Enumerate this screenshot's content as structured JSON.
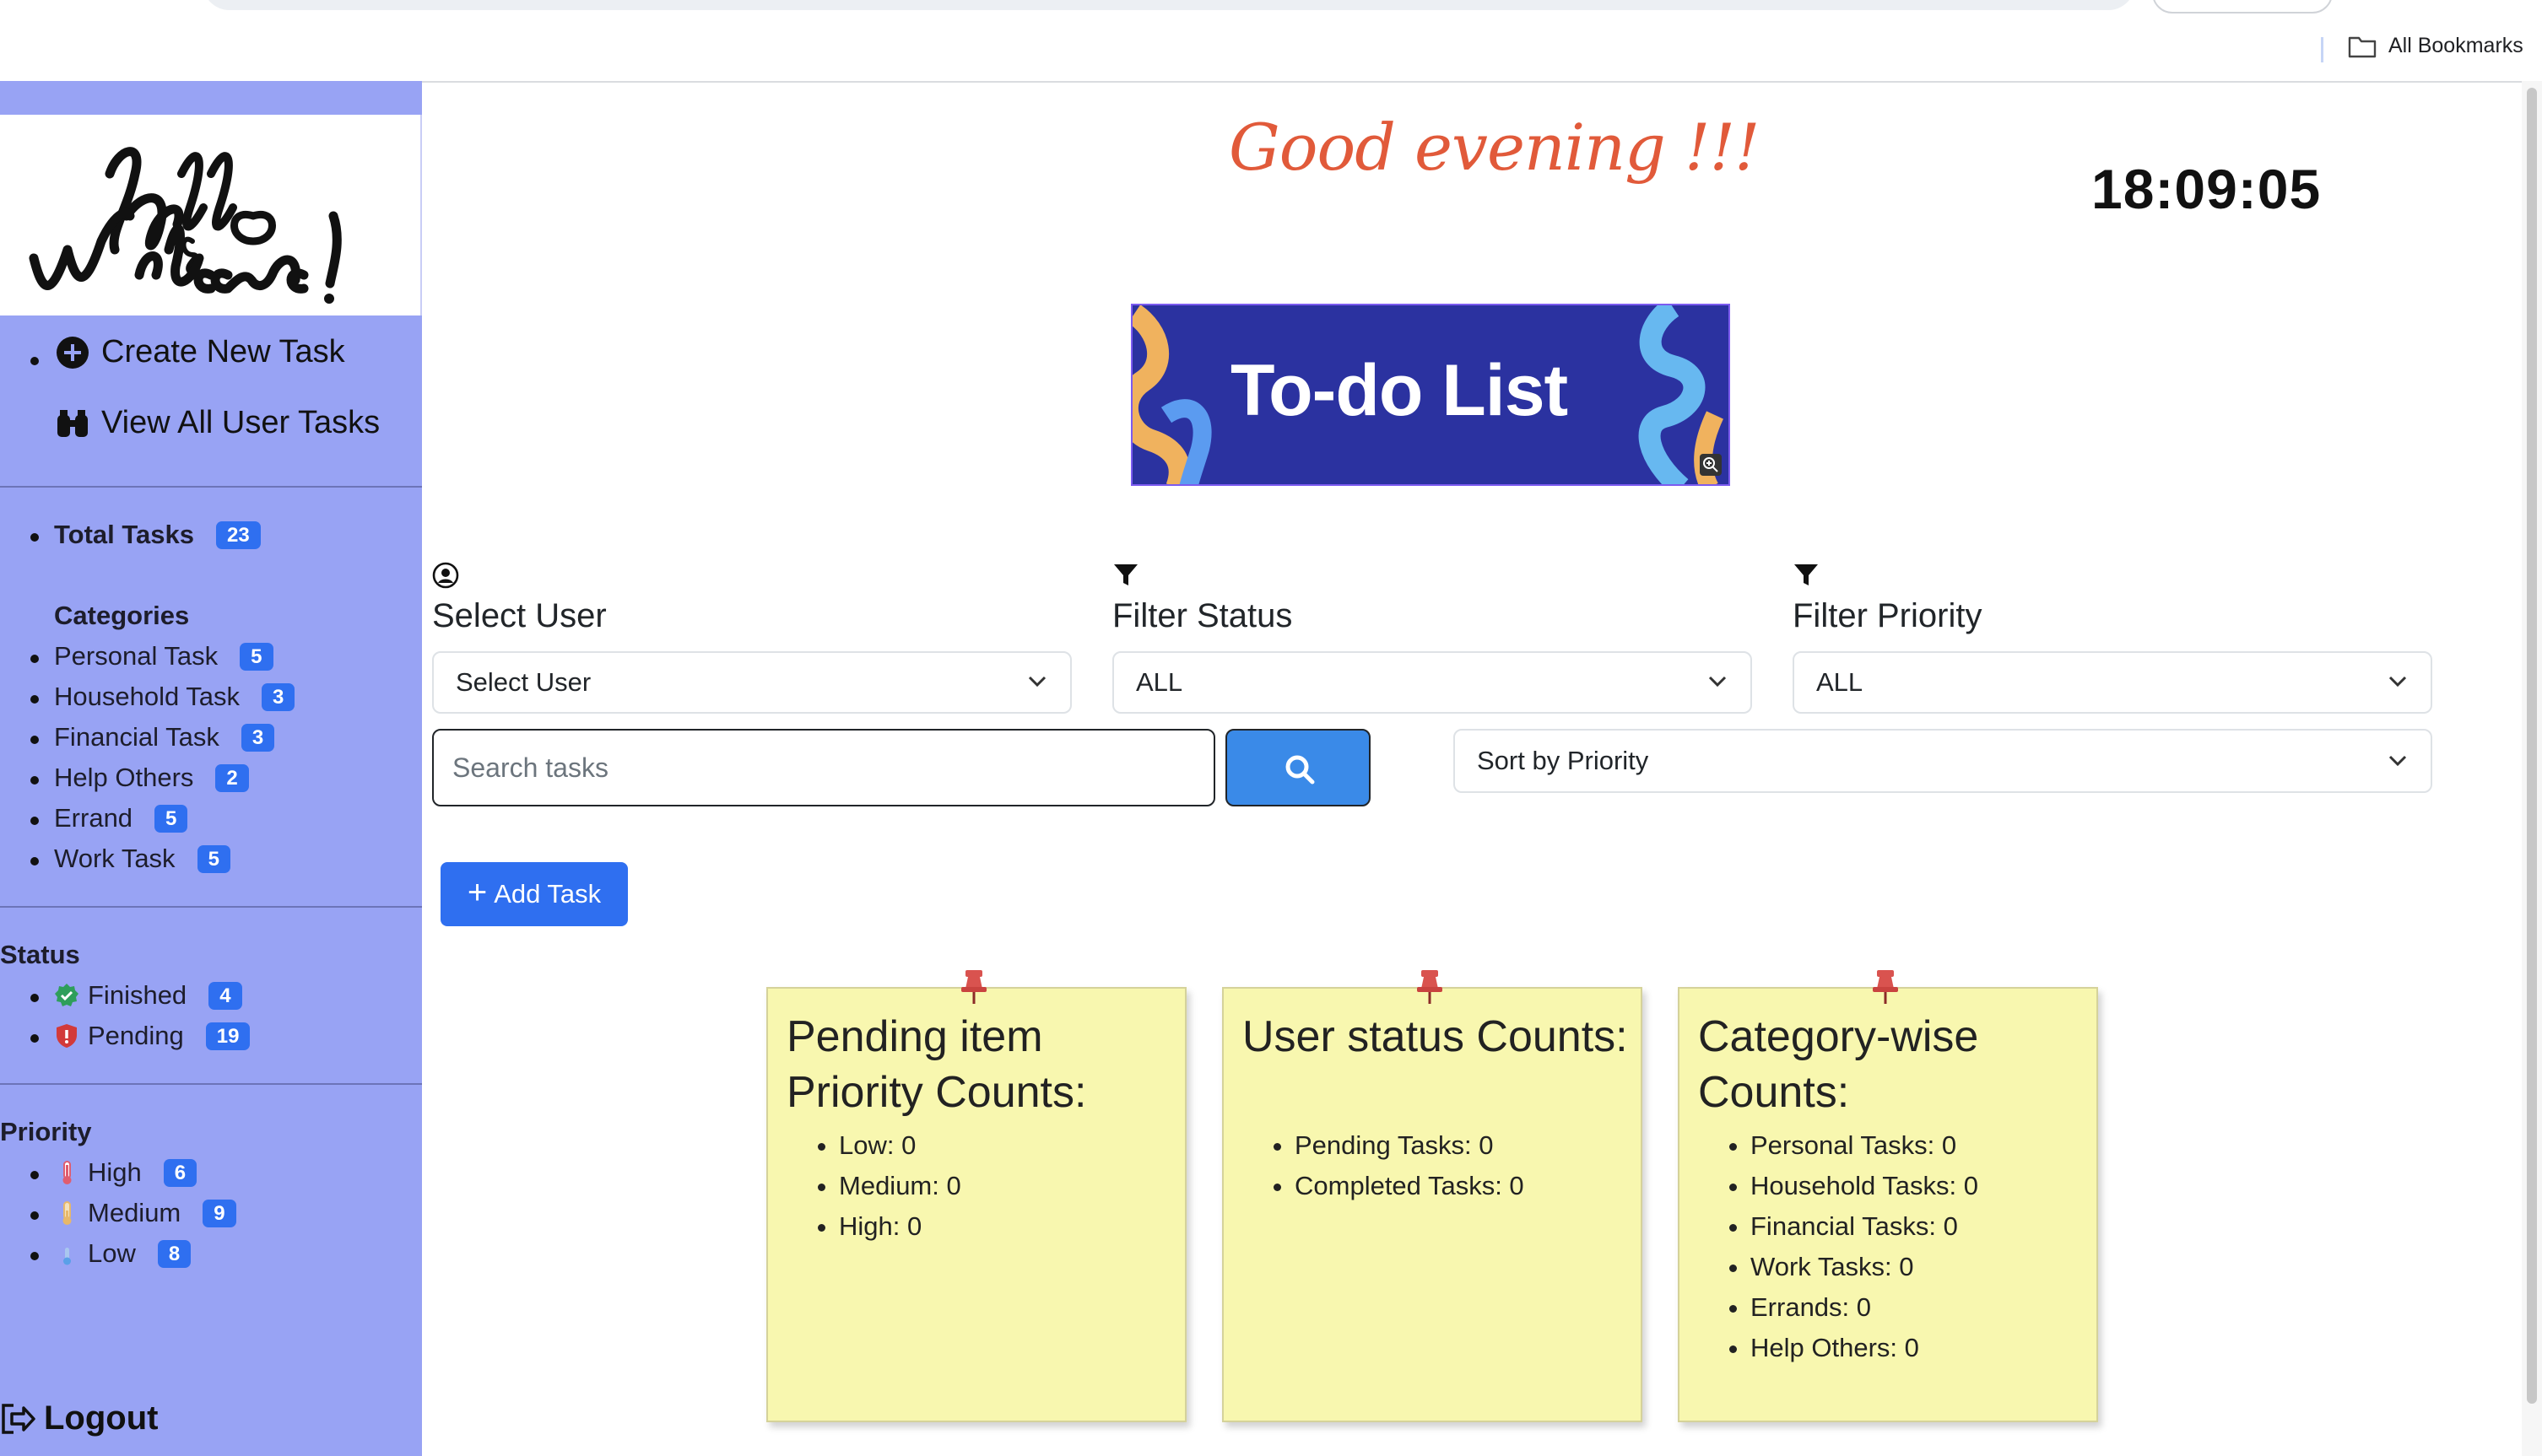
{
  "browser": {
    "bookmarks_label": "All Bookmarks"
  },
  "sidebar": {
    "links": [
      {
        "label": "Create New Task",
        "icon": "plus-circle-icon"
      },
      {
        "label": "View All User Tasks",
        "icon": "binoculars-icon"
      }
    ],
    "total": {
      "label": "Total Tasks",
      "count": "23"
    },
    "categories_heading": "Categories",
    "categories": [
      {
        "label": "Personal Task",
        "count": "5"
      },
      {
        "label": "Household Task",
        "count": "3"
      },
      {
        "label": "Financial Task",
        "count": "3"
      },
      {
        "label": "Help Others",
        "count": "2"
      },
      {
        "label": "Errand",
        "count": "5"
      },
      {
        "label": "Work Task",
        "count": "5"
      }
    ],
    "status_heading": "Status",
    "status": [
      {
        "label": "Finished",
        "count": "4",
        "icon": "check-badge-icon",
        "color": "#2e9e5b"
      },
      {
        "label": "Pending",
        "count": "19",
        "icon": "shield-exclamation-icon",
        "color": "#d23a3a"
      }
    ],
    "priority_heading": "Priority",
    "priority": [
      {
        "label": "High",
        "count": "6",
        "icon": "thermometer-high-icon",
        "color": "#e05d6f"
      },
      {
        "label": "Medium",
        "count": "9",
        "icon": "thermometer-medium-icon",
        "color": "#e8b86a"
      },
      {
        "label": "Low",
        "count": "8",
        "icon": "thermometer-low-icon",
        "color": "#5aa0e8"
      }
    ],
    "logout_label": "Logout"
  },
  "header": {
    "greeting": "Good evening !!!",
    "clock": "18:09:05",
    "banner_text": "To-do List"
  },
  "filters": {
    "user": {
      "label": "Select User",
      "value": "Select User",
      "icon": "user-circle-icon"
    },
    "status": {
      "label": "Filter Status",
      "value": "ALL",
      "icon": "funnel-icon"
    },
    "priority": {
      "label": "Filter Priority",
      "value": "ALL",
      "icon": "funnel-icon"
    },
    "search_placeholder": "Search tasks",
    "sort_value": "Sort by Priority"
  },
  "add_task_label": "Add Task",
  "notes": [
    {
      "title": "Pending item Priority Counts:",
      "items": [
        "Low: 0",
        "Medium: 0",
        "High: 0"
      ]
    },
    {
      "title": "User status Counts:",
      "items": [
        "Pending Tasks: 0",
        "Completed Tasks: 0"
      ]
    },
    {
      "title": "Category-wise Counts:",
      "items": [
        "Personal Tasks: 0",
        "Household Tasks: 0",
        "Financial Tasks: 0",
        "Work Tasks: 0",
        "Errands: 0",
        "Help Others: 0"
      ]
    }
  ],
  "colors": {
    "sidebar_bg": "#98a3f4",
    "badge": "#2f6ff0",
    "greeting": "#e15a3a",
    "banner_bg": "#2b32a0",
    "note_bg": "#f8f7af",
    "search_button": "#3a8ae8"
  }
}
